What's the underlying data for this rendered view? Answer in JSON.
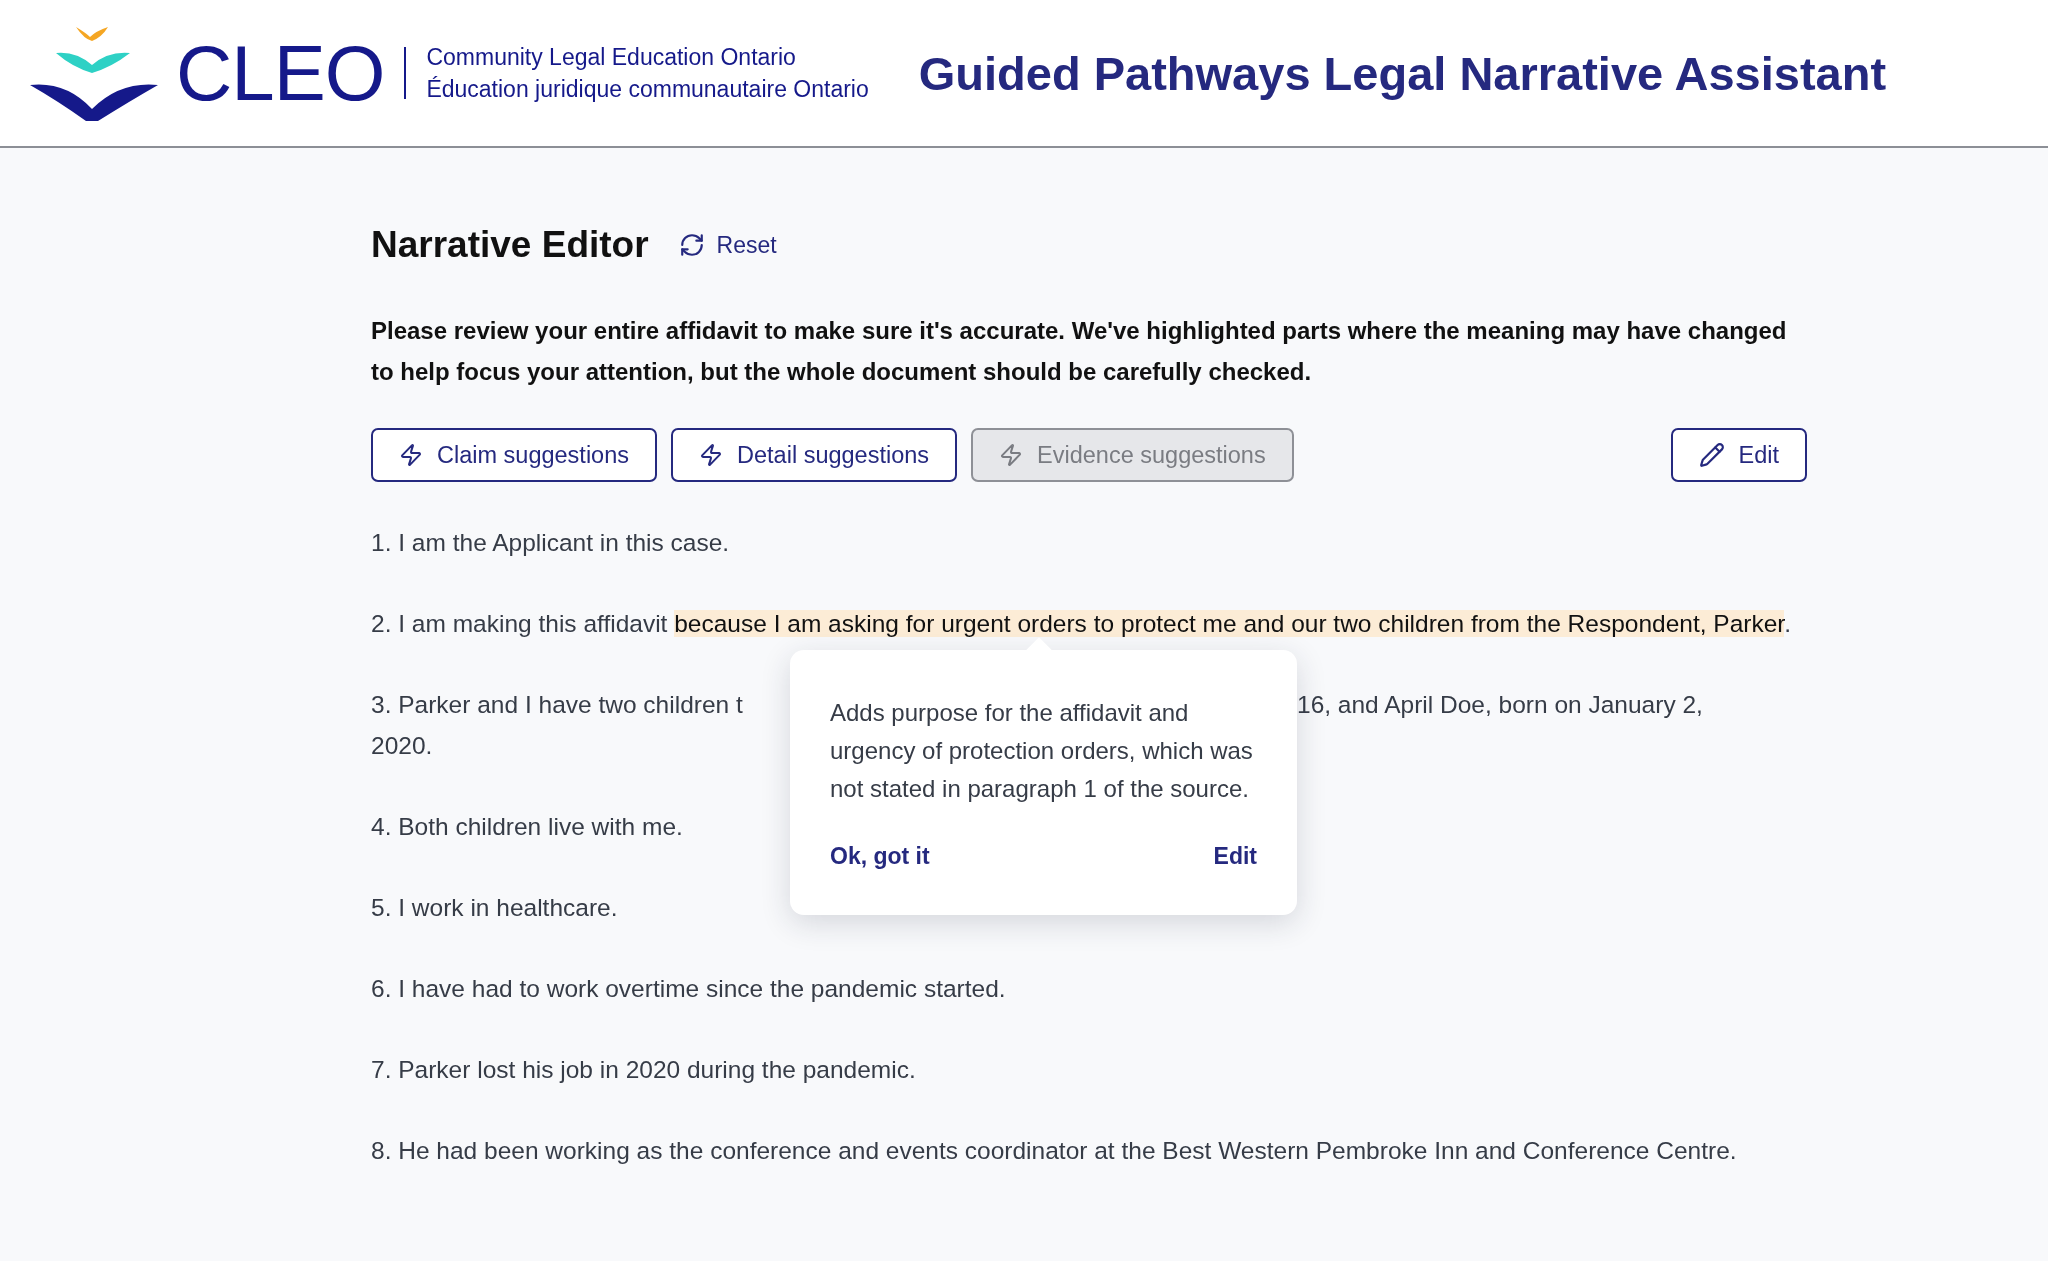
{
  "header": {
    "logo_text": "CLEO",
    "org_name_en": "Community Legal Education Ontario",
    "org_name_fr": "Éducation juridique communautaire Ontario",
    "app_title": "Guided Pathways Legal Narrative Assistant"
  },
  "editor": {
    "title": "Narrative Editor",
    "reset_label": "Reset",
    "instructions": "Please review your entire affidavit to make sure it's accurate. We've highlighted parts where the meaning may have changed to help focus your attention, but the whole document should be carefully checked.",
    "suggestion_buttons": [
      {
        "label": "Claim suggestions",
        "disabled": false
      },
      {
        "label": "Detail suggestions",
        "disabled": false
      },
      {
        "label": "Evidence suggestions",
        "disabled": true
      }
    ],
    "edit_label": "Edit"
  },
  "paragraphs": [
    {
      "kind": "plain",
      "segments": [
        {
          "text": "1. I am the Applicant in this case.",
          "highlighted": false
        }
      ]
    },
    {
      "kind": "plain",
      "segments": [
        {
          "text": "2. I am making this affidavit ",
          "highlighted": false
        },
        {
          "text": "because I am asking for urgent orders to protect me and our two children from the Respondent, Parker",
          "highlighted": true
        },
        {
          "text": ".",
          "highlighted": false
        }
      ]
    },
    {
      "kind": "covered",
      "visible_start": "3. Parker and I have two children t",
      "visible_end": "16, and April Doe, born on January 2,",
      "continuation": "2020.",
      "popover": {
        "text": "Adds purpose for the affidavit and urgency of protection orders, which was not stated in paragraph 1 of the source.",
        "dismiss_label": "Ok, got it",
        "edit_label": "Edit"
      }
    },
    {
      "kind": "plain",
      "segments": [
        {
          "text": "4. Both children live with me.",
          "highlighted": false
        }
      ]
    },
    {
      "kind": "plain",
      "segments": [
        {
          "text": "5. I work in healthcare.",
          "highlighted": false
        }
      ]
    },
    {
      "kind": "plain",
      "segments": [
        {
          "text": "6. I have had to work overtime since the pandemic started.",
          "highlighted": false
        }
      ]
    },
    {
      "kind": "plain",
      "segments": [
        {
          "text": "7. Parker lost his job in 2020 during the pandemic.",
          "highlighted": false
        }
      ]
    },
    {
      "kind": "plain",
      "segments": [
        {
          "text": "8. He had been working as the conference and events coordinator at the Best Western Pembroke Inn and Conference Centre.",
          "highlighted": false
        }
      ]
    }
  ]
}
